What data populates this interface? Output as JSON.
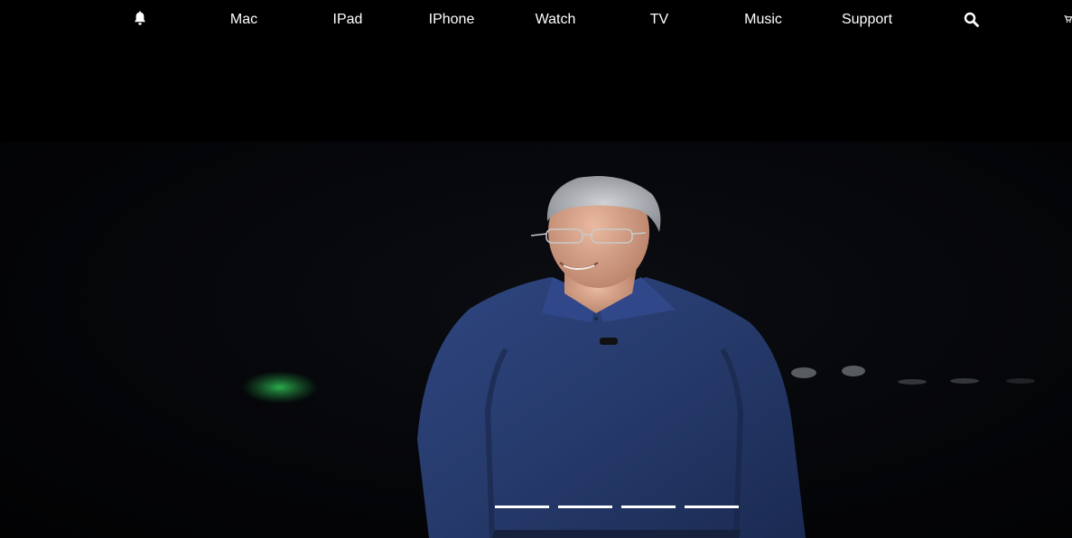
{
  "nav": {
    "bell_icon": "bell-icon",
    "items": [
      {
        "label": "Mac"
      },
      {
        "label": "IPad"
      },
      {
        "label": "IPhone"
      },
      {
        "label": "Watch"
      },
      {
        "label": "TV"
      },
      {
        "label": "Music"
      },
      {
        "label": "Support"
      }
    ],
    "search_icon": "search-icon",
    "cart_icon": "cart-icon"
  },
  "hero": {
    "slide_count": 4,
    "active_slide": 1,
    "colors": {
      "background": "#000000",
      "shirt": "#263a6b",
      "exit_sign": "#1f8a3a"
    }
  }
}
